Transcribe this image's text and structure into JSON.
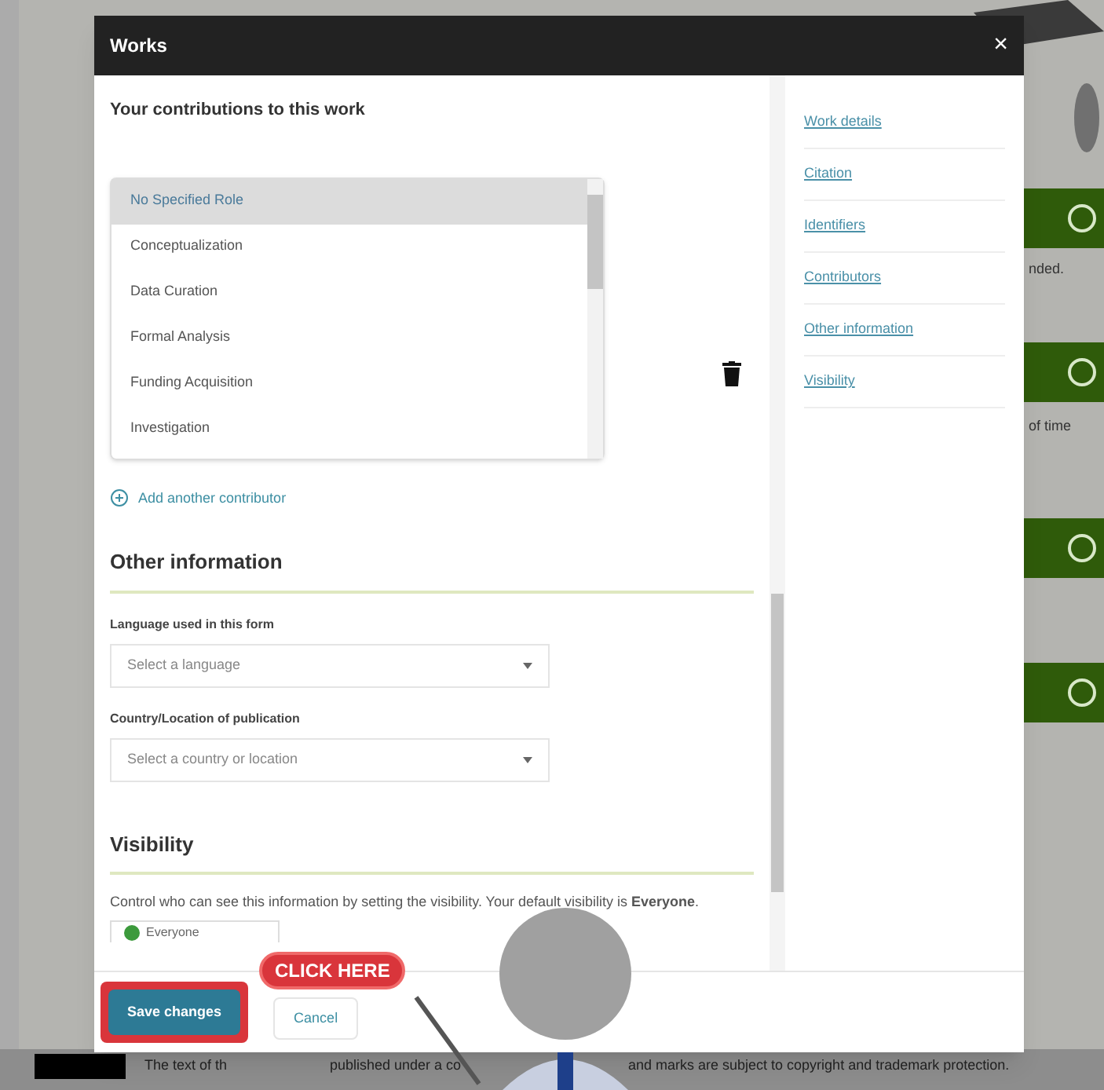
{
  "modal": {
    "title": "Works",
    "close": "×"
  },
  "contributions": {
    "heading": "Your contributions to this work",
    "roles": [
      {
        "label": "No Specified Role",
        "selected": true
      },
      {
        "label": "Conceptualization",
        "selected": false
      },
      {
        "label": "Data Curation",
        "selected": false
      },
      {
        "label": "Formal Analysis",
        "selected": false
      },
      {
        "label": "Funding Acquisition",
        "selected": false
      },
      {
        "label": "Investigation",
        "selected": false
      }
    ],
    "add_link": "Add another contributor"
  },
  "other_information": {
    "heading": "Other information",
    "fields": [
      {
        "label": "Language used in this form",
        "placeholder": "Select a language"
      },
      {
        "label": "Country/Location of publication",
        "placeholder": "Select a country or location"
      }
    ]
  },
  "visibility": {
    "heading": "Visibility",
    "description": "Control who can see this information by setting the visibility. Your default visibility is **Everyone**.",
    "value": "Everyone"
  },
  "nav": [
    {
      "label": "Work details"
    },
    {
      "label": "Citation"
    },
    {
      "label": "Identifiers"
    },
    {
      "label": "Contributors"
    },
    {
      "label": "Other information"
    },
    {
      "label": "Visibility"
    }
  ],
  "buttons": {
    "save": "Save changes",
    "cancel": "Cancel"
  },
  "callout": "CLICK HERE",
  "background": {
    "fragments": [
      "nded.",
      "of time"
    ],
    "footer": [
      "The text of th",
      "published under a co",
      "and marks are subject to copyright and trademark protection."
    ]
  }
}
